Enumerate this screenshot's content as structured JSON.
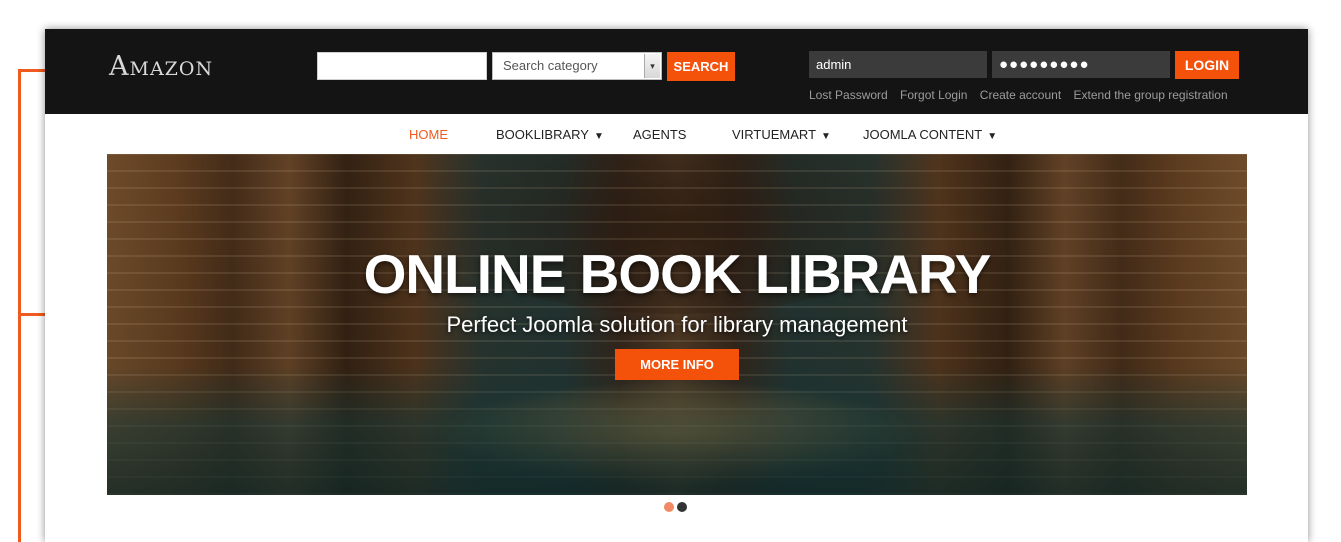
{
  "header": {
    "logo_text": "Amazon",
    "search": {
      "value": "",
      "category_placeholder": "Search category",
      "button_label": "SEARCH"
    },
    "login": {
      "username_value": "admin",
      "password_mask": "●●●●●●●●●",
      "button_label": "LOGIN",
      "links": [
        "Lost Password",
        "Forgot Login",
        "Create account",
        "Extend the group registration"
      ]
    }
  },
  "nav": {
    "items": [
      {
        "label": "HOME",
        "active": true,
        "has_dropdown": false
      },
      {
        "label": "BOOKLIBRARY",
        "active": false,
        "has_dropdown": true
      },
      {
        "label": "AGENTS",
        "active": false,
        "has_dropdown": false
      },
      {
        "label": "VIRTUEMART",
        "active": false,
        "has_dropdown": true
      },
      {
        "label": "JOOMLA CONTENT",
        "active": false,
        "has_dropdown": true
      }
    ]
  },
  "hero": {
    "title": "ONLINE BOOK LIBRARY",
    "subtitle": "Perfect Joomla solution for library management",
    "button_label": "MORE INFO"
  },
  "slider": {
    "slide_count": 2,
    "active_index": 0
  },
  "colors": {
    "accent": "#f4510b",
    "topbar_bg": "#141414",
    "active_nav": "#f05a1e"
  },
  "icons": {
    "caret": "▼",
    "select_arrow": "▾"
  }
}
